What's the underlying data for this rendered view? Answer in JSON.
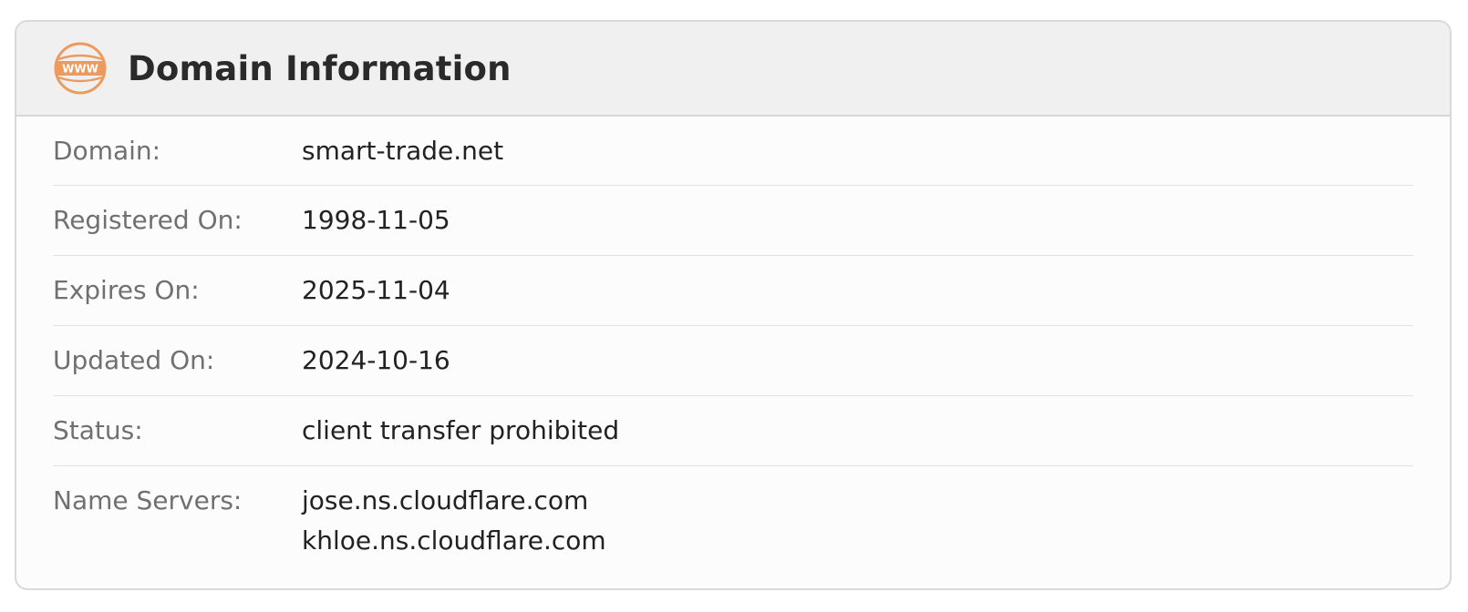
{
  "header": {
    "title": "Domain Information",
    "icon": "www-icon",
    "icon_text": "WWW",
    "icon_color": "#ef9a5d"
  },
  "rows": [
    {
      "label": "Domain:",
      "value": "smart-trade.net"
    },
    {
      "label": "Registered On:",
      "value": "1998-11-05"
    },
    {
      "label": "Expires On:",
      "value": "2025-11-04"
    },
    {
      "label": "Updated On:",
      "value": "2024-10-16"
    },
    {
      "label": "Status:",
      "value": "client transfer prohibited"
    }
  ],
  "name_servers": {
    "label": "Name Servers:",
    "values": [
      "jose.ns.cloudflare.com",
      "khloe.ns.cloudflare.com"
    ]
  },
  "colors": {
    "header_bg": "#f0f0f0",
    "label_text": "#707070",
    "value_text": "#222222",
    "accent": "#ef9a5d"
  }
}
